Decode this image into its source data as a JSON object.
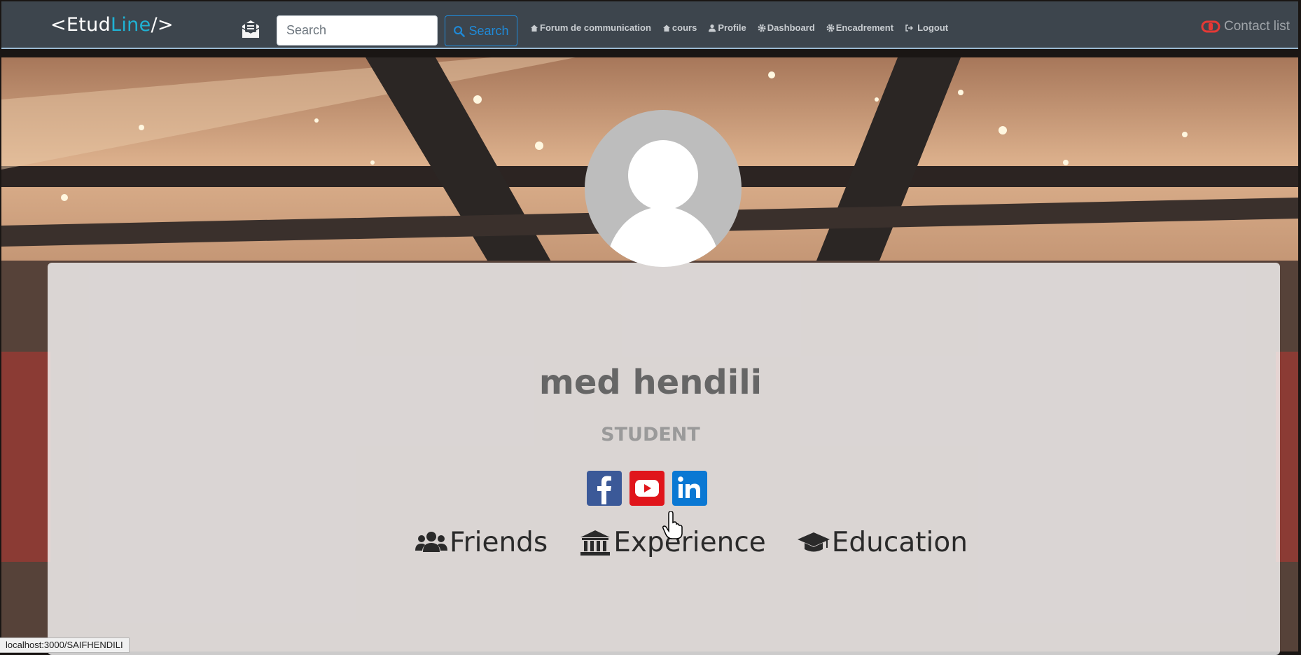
{
  "nav": {
    "brand_open": "<Etud",
    "brand_highlight": "Line",
    "brand_close": "/>",
    "search_placeholder": "Search",
    "search_button": "Search",
    "links": [
      {
        "label": "Forum de communication",
        "icon": "home-icon"
      },
      {
        "label": "cours",
        "icon": "home-icon"
      },
      {
        "label": "Profile",
        "icon": "user-icon"
      },
      {
        "label": "Dashboard",
        "icon": "gear-icon"
      },
      {
        "label": "Encadrement",
        "icon": "gear-icon"
      },
      {
        "label": "Logout",
        "icon": "logout-icon"
      }
    ],
    "contact": "Contact list"
  },
  "profile": {
    "name": "med hendili",
    "role": "STUDENT",
    "socials": [
      "facebook-icon",
      "youtube-icon",
      "linkedin-icon"
    ],
    "tabs": [
      {
        "label": "Friends",
        "icon": "users-icon"
      },
      {
        "label": "Experience",
        "icon": "university-icon"
      },
      {
        "label": "Education",
        "icon": "graduation-cap-icon"
      }
    ]
  },
  "status_url": "localhost:3000/SAIFHENDILI",
  "colors": {
    "navbar": "#3d454d",
    "brand_accent": "#1fb2d4",
    "search_button": "#1f8ad8",
    "contact_icon": "#e53935"
  }
}
